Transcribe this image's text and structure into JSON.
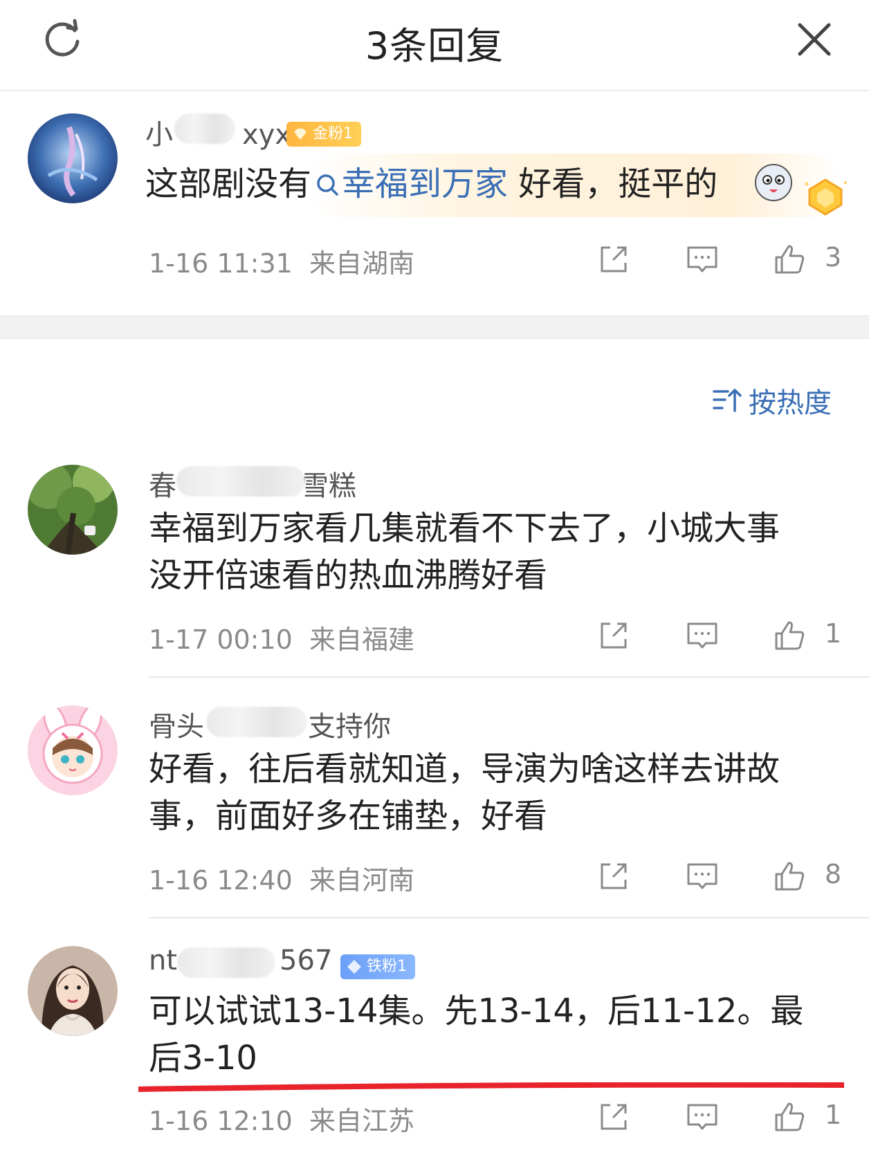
{
  "header": {
    "title": "3条回复",
    "refresh_icon": "refresh-icon",
    "close_icon": "close-icon"
  },
  "main_comment": {
    "username_prefix": "小",
    "username_suffix": "xyx",
    "badge": "金粉1",
    "text_before": "这部剧没有",
    "topic": "幸福到万家",
    "text_after": " 好看，挺平的",
    "time": "1-16 11:31",
    "location": "来自湖南",
    "likes": "3"
  },
  "sort": {
    "label": "按热度"
  },
  "replies": [
    {
      "username_prefix": "春",
      "username_suffix": "雪糕",
      "lines": [
        "幸福到万家看几集就看不下去了，小城大事",
        "没开倍速看的热血沸腾好看"
      ],
      "time": "1-17 00:10",
      "location": "来自福建",
      "likes": "1"
    },
    {
      "username_prefix": "骨头",
      "username_suffix": "支持你",
      "lines": [
        "好看，往后看就知道，导演为啥这样去讲故",
        "事，前面好多在铺垫，好看"
      ],
      "time": "1-16 12:40",
      "location": "来自河南",
      "likes": "8"
    },
    {
      "username_prefix": "nt",
      "username_suffix": "567",
      "badge": "铁粉1",
      "lines": [
        "可以试试13-14集。先13-14，后11-12。最",
        "后3-10"
      ],
      "time": "1-16 12:10",
      "location": "来自江苏",
      "likes": "1"
    }
  ],
  "colors": {
    "link": "#3a6fb5",
    "meta": "#8a8a8a",
    "badge_gold": "#ffb640",
    "badge_iron": "#6b9ff7",
    "underline": "#e8232b"
  }
}
